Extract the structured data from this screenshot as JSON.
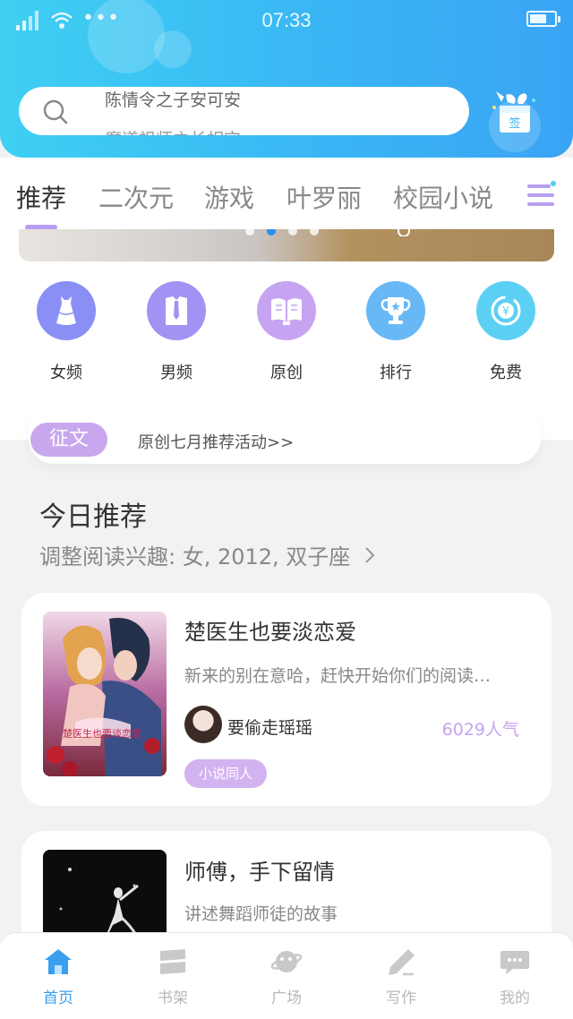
{
  "status_bar": {
    "time": "07:33",
    "dots": "•••"
  },
  "search": {
    "placeholder": "陈情令之子安可安",
    "next_hint": "魔道祖师之长相守"
  },
  "sign_in": {
    "label": "签"
  },
  "tabs": [
    {
      "label": "推荐",
      "active": true
    },
    {
      "label": "二次元"
    },
    {
      "label": "游戏"
    },
    {
      "label": "叶罗丽"
    },
    {
      "label": "校园小说"
    }
  ],
  "categories": [
    {
      "label": "女频",
      "icon": "dress-icon",
      "color": "#8a8ff5"
    },
    {
      "label": "男频",
      "icon": "shirt-tie-icon",
      "color": "#a093f3"
    },
    {
      "label": "原创",
      "icon": "open-book-icon",
      "color": "#c7a4f1"
    },
    {
      "label": "排行",
      "icon": "trophy-icon",
      "color": "#69b8f6"
    },
    {
      "label": "免费",
      "icon": "yuan-coin-icon",
      "color": "#5cd0f4"
    }
  ],
  "notice": {
    "tag": "征文",
    "text": "原创七月推荐活动>>"
  },
  "recommend": {
    "title": "今日推荐",
    "subtitle": "调整阅读兴趣: 女, 2012, 双子座"
  },
  "books": [
    {
      "title": "楚医生也要淡恋爱",
      "desc": "新来的别在意哈，赶快开始你们的阅读…",
      "author": "要偷走瑶瑶",
      "popularity": "6029人气",
      "genre": "小说同人",
      "cover_text": "楚医生也要谈恋爱"
    },
    {
      "title": "师傅，手下留情",
      "desc": "讲述舞蹈师徒的故事"
    }
  ],
  "bottom_nav": [
    {
      "label": "首页",
      "icon": "home-icon",
      "active": true
    },
    {
      "label": "书架",
      "icon": "bookshelf-icon"
    },
    {
      "label": "广场",
      "icon": "planet-icon"
    },
    {
      "label": "写作",
      "icon": "pen-icon"
    },
    {
      "label": "我的",
      "icon": "chat-bubble-icon"
    }
  ],
  "colors": {
    "header": "#39b4f5",
    "accent": "#b89ef0",
    "nav_active": "#3a9ff0"
  }
}
